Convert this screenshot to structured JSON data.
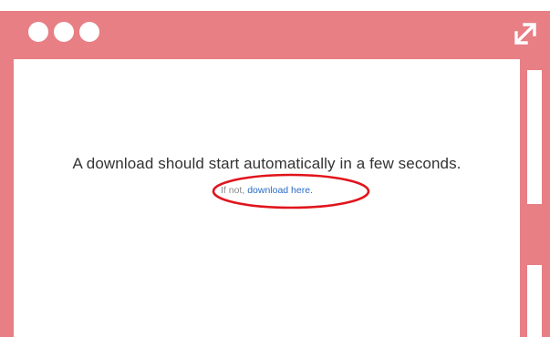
{
  "window": {
    "frame_color": "#e77f85",
    "controls": [
      "dot",
      "dot",
      "dot"
    ],
    "expand_icon": "expand-arrows-icon"
  },
  "content": {
    "message": "A download should start automatically in a few seconds.",
    "fallback_prefix": "If not, ",
    "fallback_link": "download here.",
    "link_color": "#2a6bc7",
    "highlight_color": "#e0141c"
  },
  "background": {
    "accent_color": "#1d5a8a"
  }
}
